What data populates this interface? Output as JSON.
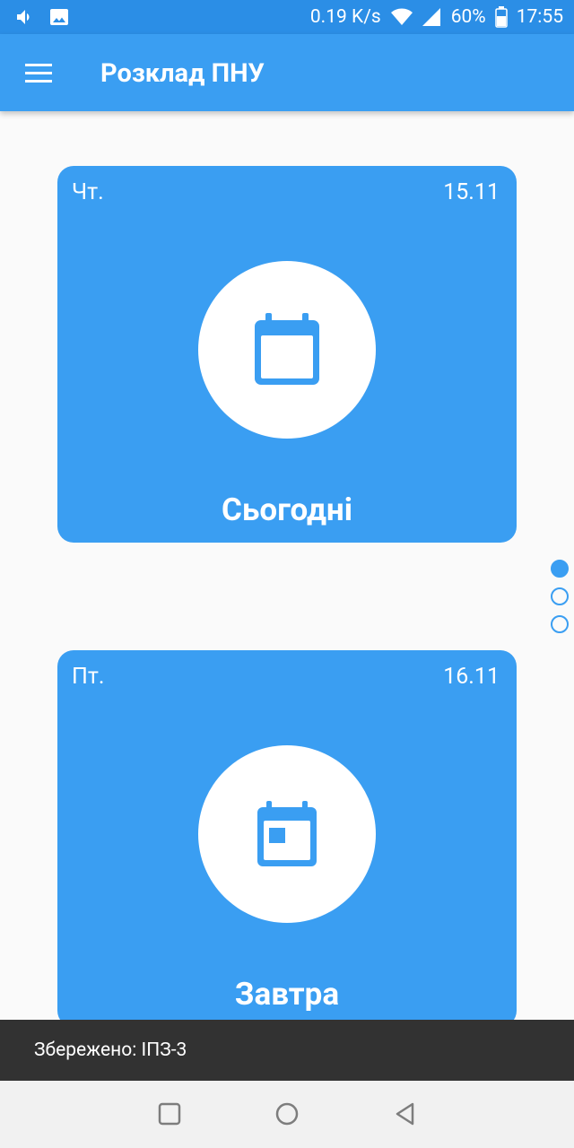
{
  "status_bar": {
    "net_speed": "0.19 K/s",
    "battery": "60%",
    "time": "17:55",
    "icons": [
      "volume-icon",
      "image-icon",
      "wifi-icon",
      "signal-icon",
      "battery-icon"
    ]
  },
  "app_bar": {
    "title": "Розклад ПНУ",
    "menu_icon": "menu-icon"
  },
  "cards": [
    {
      "day": "Чт.",
      "date": "15.11",
      "label": "Сьогодні",
      "icon": "calendar-icon"
    },
    {
      "day": "Пт.",
      "date": "16.11",
      "label": "Завтра",
      "icon": "calendar-event-icon"
    }
  ],
  "pager": {
    "count": 3,
    "active": 0
  },
  "snackbar": {
    "text": "Збережено: ІПЗ-3"
  },
  "colors": {
    "primary": "#3a9ef2",
    "status_bar": "#2b8ee6",
    "snackbar": "#323232",
    "background": "#fafafa"
  }
}
